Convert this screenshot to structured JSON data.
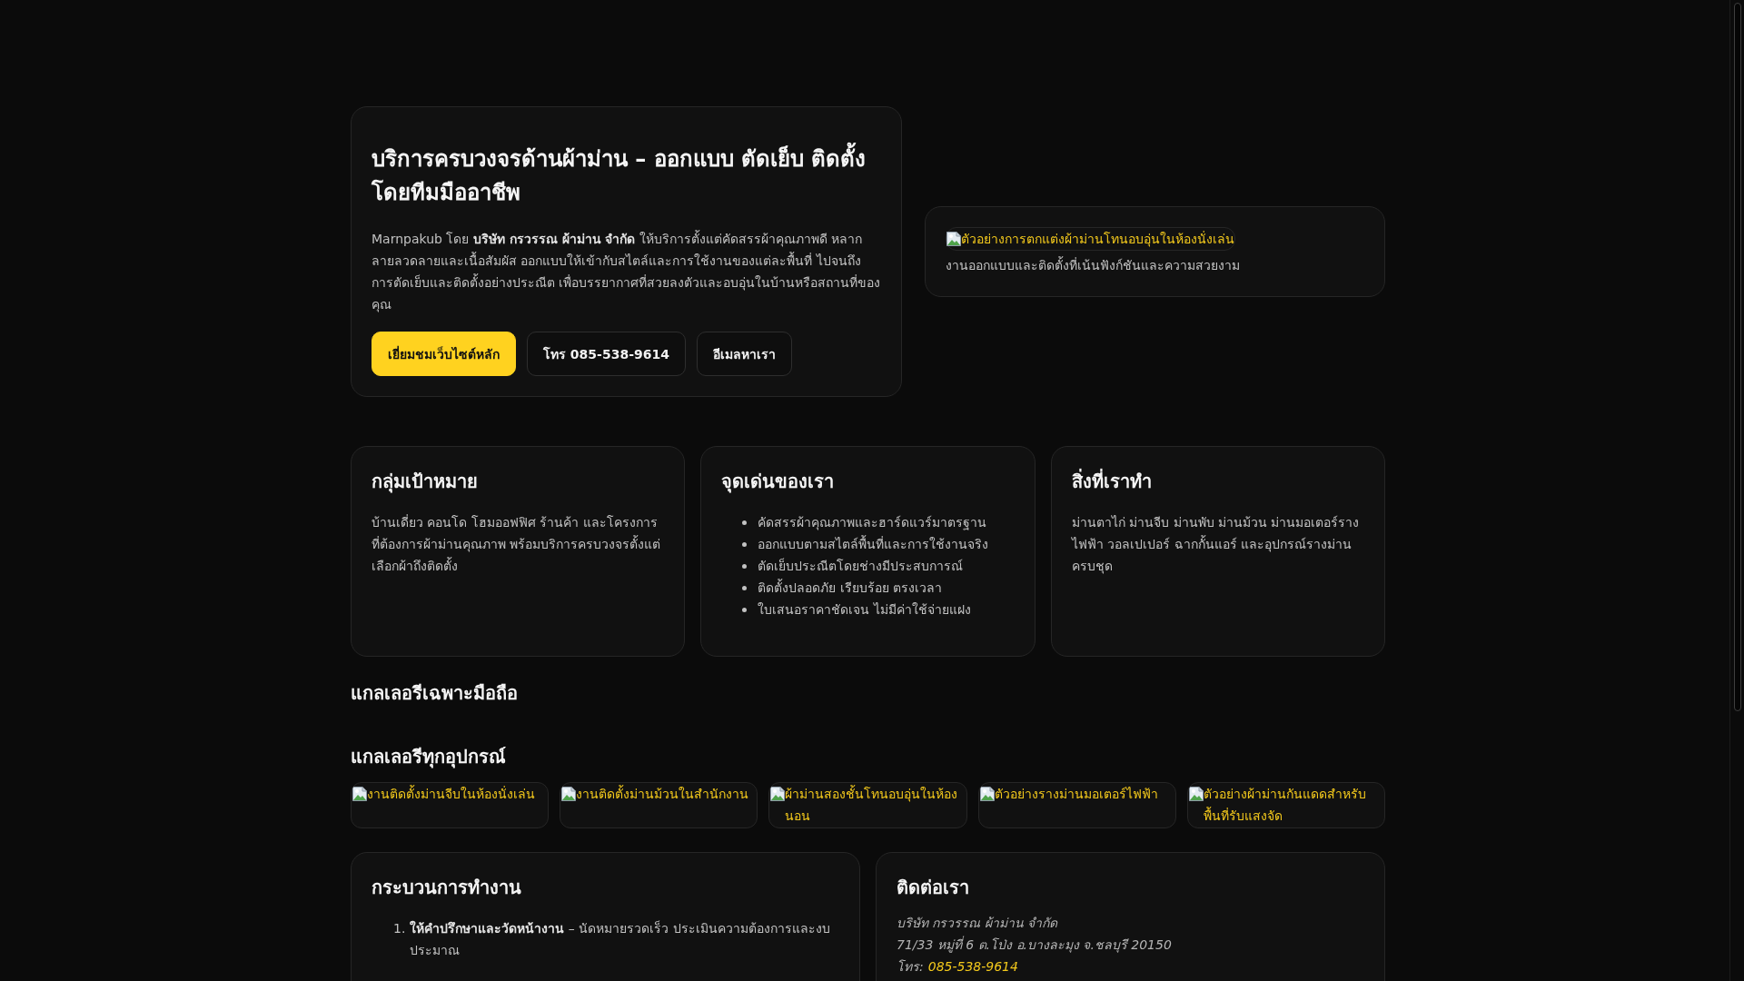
{
  "hero": {
    "title": "บริการครบวงจรด้านผ้าม่าน – ออกแบบ ตัดเย็บ ติดตั้ง โดยทีมมืออาชีพ",
    "intro": "Marnpakub โดย **บริษัท กรวรรณ ผ้าม่าน จำกัด** ให้บริการตั้งแต่คัดสรรผ้าคุณภาพดี หลากลายลวดลายและเนื้อสัมผัส ออกแบบให้เข้ากับสไตล์และการใช้งานของแต่ละพื้นที่ ไปจนถึงการตัดเย็บและติดตั้งอย่างประณีต เพื่อบรรยากาศที่สวยลงตัวและอบอุ่นในบ้านหรือสถานที่ของคุณ",
    "buttons": [
      {
        "label": "เยี่ยมชมเว็บไซต์หลัก",
        "kind": "primary"
      },
      {
        "label": "โทร 085-538-9614",
        "kind": "outline"
      },
      {
        "label": "อีเมลหาเรา",
        "kind": "outline"
      }
    ]
  },
  "feature_image": {
    "alt_text": "ตัวอย่างการตกแต่งผ้าม่านโทนอบอุ่นในห้องนั่งเล่น",
    "caption": "งานออกแบบและติดตั้งที่เน้นฟังก์ชันและความสวยงาม"
  },
  "info_cards": [
    {
      "title": "กลุ่มเป้าหมาย",
      "kind": "text",
      "text": "บ้านเดี่ยว คอนโด โฮมออฟฟิศ ร้านค้า และโครงการที่ต้องการผ้าม่านคุณภาพ พร้อมบริการครบวงจรตั้งแต่เลือกผ้าถึงติดตั้ง"
    },
    {
      "title": "จุดเด่นของเรา",
      "kind": "list",
      "items": [
        "คัดสรรผ้าคุณภาพและฮาร์ดแวร์มาตรฐาน",
        "ออกแบบตามสไตล์พื้นที่และการใช้งานจริง",
        "ตัดเย็บประณีตโดยช่างมีประสบการณ์",
        "ติดตั้งปลอดภัย เรียบร้อย ตรงเวลา",
        "ใบเสนอราคาชัดเจน ไม่มีค่าใช้จ่ายแฝง"
      ]
    },
    {
      "title": "สิ่งที่เราทำ",
      "kind": "text",
      "text": "ม่านตาไก่ ม่านจีบ ม่านพับ ม่านม้วน ม่านมอเตอร์รางไฟฟ้า วอลเปเปอร์ ฉากกั้นแอร์ และอุปกรณ์รางม่านครบชุด"
    }
  ],
  "mobile_gallery": {
    "title": "แกลเลอรีเฉพาะมือถือ"
  },
  "gallery": {
    "title": "แกลเลอรีทุกอุปกรณ์",
    "images": [
      {
        "alt_text": "งานติดตั้งม่านจีบในห้องนั่งเล่น"
      },
      {
        "alt_text": "งานติดตั้งม่านม้วนในสำนักงาน"
      },
      {
        "alt_text": "ผ้าม่านสองชั้นโทนอบอุ่นในห้องนอน"
      },
      {
        "alt_text": "ตัวอย่างรางม่านมอเตอร์ไฟฟ้า"
      },
      {
        "alt_text": "ตัวอย่างผ้าม่านกันแดดสำหรับพื้นที่รับแสงจัด"
      }
    ]
  },
  "process": {
    "title": "กระบวนการทำงาน",
    "steps": [
      {
        "number": "1.",
        "text": "**ให้คำปรึกษาและวัดหน้างาน** – นัดหมายรวดเร็ว ประเมินความต้องการและงบประมาณ"
      }
    ]
  },
  "contact": {
    "title": "ติดต่อเรา",
    "company": "บริษัท กรวรรณ ผ้าม่าน จำกัด",
    "address": "71/33 หมู่ที่ 6 ต.โป่ง อ.บางละมุง จ.ชลบุรี 20150",
    "phone_label": "โทร:",
    "phone": "085-538-9614"
  }
}
